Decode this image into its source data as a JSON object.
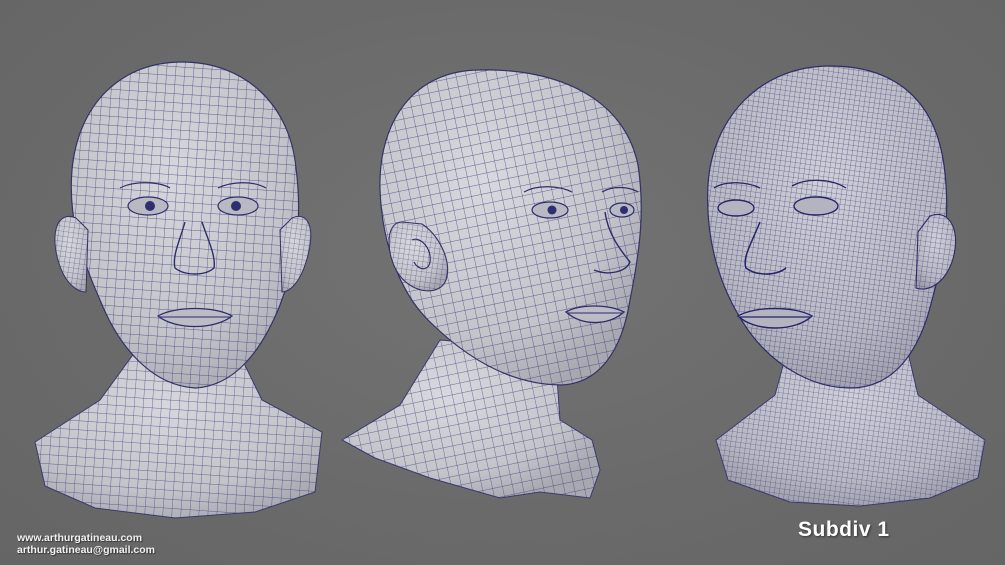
{
  "credits": {
    "website": "www.arthurgatineau.com",
    "email": "arthur.gatineau@gmail.com"
  },
  "label": "Subdiv 1",
  "colors": {
    "background": "#6b6b6b",
    "mesh_fill": "#c9c9cf",
    "wireframe": "#2a2a6e",
    "text": "#ffffff"
  },
  "views": [
    {
      "name": "front-view"
    },
    {
      "name": "three-quarter-view"
    },
    {
      "name": "three-quarter-view-dense"
    }
  ]
}
